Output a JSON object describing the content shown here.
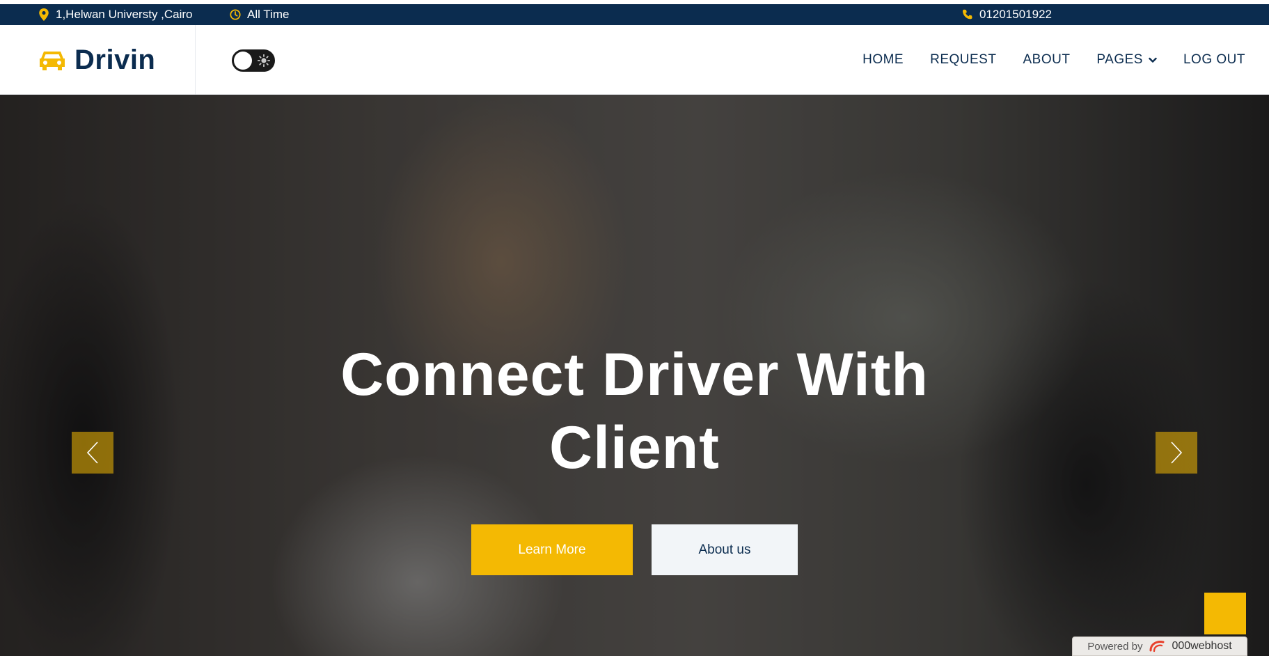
{
  "topbar": {
    "address": "1,Helwan Universty ,Cairo",
    "hours": "All Time",
    "phone": "01201501922"
  },
  "brand": {
    "name": "Drivin",
    "icon": "car-icon"
  },
  "theme_toggle": {
    "icon": "sun-icon",
    "state": "off"
  },
  "nav": {
    "items": [
      {
        "label": "HOME"
      },
      {
        "label": "REQUEST"
      },
      {
        "label": "ABOUT"
      },
      {
        "label": "PAGES"
      },
      {
        "label": "LOG OUT"
      }
    ]
  },
  "hero": {
    "title": "Connect Driver With Client",
    "primary_button": "Learn More",
    "secondary_button": "About us"
  },
  "footer_badge": {
    "prefix": "Powered by",
    "host": "000webhost"
  },
  "colors": {
    "navy": "#0b2c4f",
    "accent": "#f4b903",
    "light": "#f2f5f8"
  }
}
